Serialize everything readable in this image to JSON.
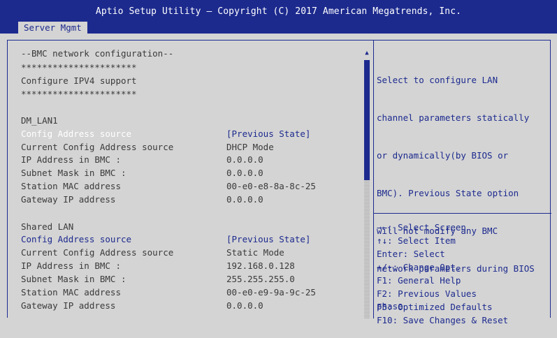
{
  "header": {
    "title": "Aptio Setup Utility – Copyright (C) 2017 American Megatrends, Inc.",
    "tab": "Server Mgmt"
  },
  "colors": {
    "accent": "#1c2a8e",
    "background": "#d4d4d4",
    "text": "#3a3a3a",
    "selected": "#ffffff"
  },
  "settings": {
    "section_title": "--BMC network configuration--",
    "stars1": "**********************",
    "ipv4": "Configure IPV4 support",
    "stars2": "**********************",
    "dm_lan1": {
      "title": "DM_LAN1",
      "items": [
        {
          "label": "Config Address source",
          "value": "[Previous State]"
        },
        {
          "label": "Current Config Address source",
          "value": "DHCP Mode"
        },
        {
          "label": "IP Address in BMC :",
          "value": "0.0.0.0"
        },
        {
          "label": "Subnet Mask in BMC :",
          "value": "0.0.0.0"
        },
        {
          "label": "Station MAC address",
          "value": "00-e0-e8-8a-8c-25"
        },
        {
          "label": "Gateway IP address",
          "value": "0.0.0.0"
        }
      ]
    },
    "shared_lan": {
      "title": "Shared LAN",
      "items": [
        {
          "label": "Config Address source",
          "value": "[Previous State]"
        },
        {
          "label": "Current Config Address source",
          "value": "Static Mode"
        },
        {
          "label": "IP Address in BMC :",
          "value": "192.168.0.128"
        },
        {
          "label": "Subnet Mask in BMC :",
          "value": "255.255.255.0"
        },
        {
          "label": "Station MAC address",
          "value": "00-e0-e9-9a-9c-25"
        },
        {
          "label": "Gateway IP address",
          "value": "0.0.0.0"
        }
      ]
    }
  },
  "help": {
    "lines": [
      "Select to configure LAN",
      "channel parameters statically",
      "or dynamically(by BIOS or",
      "BMC). Previous State option",
      "will not modify any BMC",
      "network parameters during BIOS",
      "phase"
    ]
  },
  "keys": [
    "→←: Select Screen",
    "↑↓: Select Item",
    "Enter: Select",
    "+/-: Change Opt.",
    "F1: General Help",
    "F2: Previous Values",
    "F5: Optimized Defaults",
    "F10: Save Changes & Reset"
  ]
}
